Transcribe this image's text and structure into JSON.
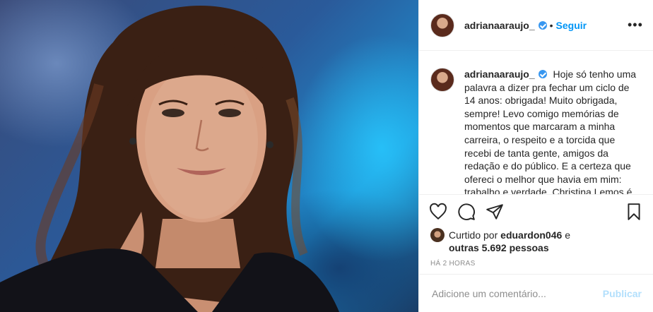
{
  "post": {
    "username": "adrianaaraujo_",
    "verified": true,
    "follow_label": "Seguir",
    "separator": "•",
    "more_label": "•••",
    "caption": "Hoje só tenho uma palavra a dizer pra fechar um ciclo de 14 anos: obrigada! Muito obrigada, sempre! Levo comigo memórias de momentos que marcaram a minha carreira, o respeito e a torcida que recebi de tanta gente, amigos da redação e do público. E a certeza que ofereci o melhor que havia em mim: trabalho e verdade. Christina Lemos é",
    "likes_prefix": "Curtido por",
    "likes_user": "eduardon046",
    "likes_and": "e",
    "likes_others": "outras 5.692 pessoas",
    "timestamp": "HÁ 2 HORAS",
    "comment_placeholder": "Adicione um comentário...",
    "publish_label": "Publicar"
  },
  "colors": {
    "accent": "#0095f6",
    "publish_disabled": "#b2dffc",
    "verified": "#3897f0",
    "muted": "#8e8e8e"
  },
  "icons": [
    "heart-icon",
    "comment-icon",
    "share-icon",
    "bookmark-icon",
    "verified-icon",
    "more-options-icon"
  ]
}
